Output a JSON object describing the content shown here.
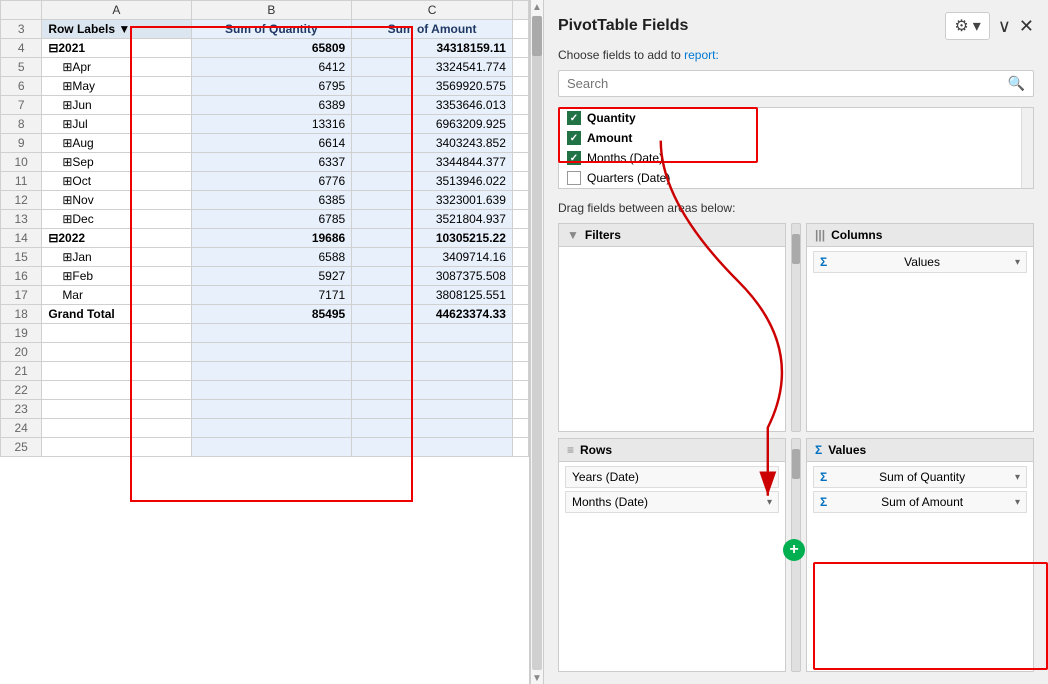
{
  "pivot_panel": {
    "title": "PivotTable Fields",
    "subtitle_text": "Choose fields to add to",
    "subtitle_link": "report:",
    "search_placeholder": "Search",
    "fields": [
      {
        "label": "Quantity",
        "checked": true,
        "bold": true
      },
      {
        "label": "Amount",
        "checked": true,
        "bold": true
      },
      {
        "label": "Months (Date)",
        "checked": true,
        "bold": false
      },
      {
        "label": "Quarters (Date)",
        "checked": false,
        "bold": false
      }
    ],
    "drag_section": "Drag fields between areas below:",
    "areas": {
      "filters": {
        "header": "Filters"
      },
      "columns": {
        "header": "Columns",
        "items": [
          {
            "label": "Values"
          }
        ]
      },
      "rows": {
        "header": "Rows",
        "items": [
          {
            "label": "Years (Date)"
          },
          {
            "label": "Months (Date)"
          }
        ]
      },
      "values": {
        "header": "Values",
        "items": [
          {
            "label": "Sum of Quantity"
          },
          {
            "label": "Sum of Amount"
          }
        ]
      }
    }
  },
  "spreadsheet": {
    "col_headers": [
      "",
      "A",
      "B",
      "C"
    ],
    "header_row": {
      "row_num": "3",
      "col_a": "Row Labels",
      "col_b": "Sum of Quantity",
      "col_c": "Sum of Amount"
    },
    "rows": [
      {
        "row_num": "4",
        "label": "⊟2021",
        "qty": "65809",
        "amt": "34318159.11",
        "type": "year"
      },
      {
        "row_num": "5",
        "label": "⊞Apr",
        "qty": "6412",
        "amt": "3324541.774",
        "type": "sub"
      },
      {
        "row_num": "6",
        "label": "⊞May",
        "qty": "6795",
        "amt": "3569920.575",
        "type": "sub"
      },
      {
        "row_num": "7",
        "label": "⊞Jun",
        "qty": "6389",
        "amt": "3353646.013",
        "type": "sub"
      },
      {
        "row_num": "8",
        "label": "⊞Jul",
        "qty": "13316",
        "amt": "6963209.925",
        "type": "sub"
      },
      {
        "row_num": "9",
        "label": "⊞Aug",
        "qty": "6614",
        "amt": "3403243.852",
        "type": "sub"
      },
      {
        "row_num": "10",
        "label": "⊞Sep",
        "qty": "6337",
        "amt": "3344844.377",
        "type": "sub"
      },
      {
        "row_num": "11",
        "label": "⊞Oct",
        "qty": "6776",
        "amt": "3513946.022",
        "type": "sub"
      },
      {
        "row_num": "12",
        "label": "⊞Nov",
        "qty": "6385",
        "amt": "3323001.639",
        "type": "sub"
      },
      {
        "row_num": "13",
        "label": "⊞Dec",
        "qty": "6785",
        "amt": "3521804.937",
        "type": "sub"
      },
      {
        "row_num": "14",
        "label": "⊟2022",
        "qty": "19686",
        "amt": "10305215.22",
        "type": "year"
      },
      {
        "row_num": "15",
        "label": "⊞Jan",
        "qty": "6588",
        "amt": "3409714.16",
        "type": "sub"
      },
      {
        "row_num": "16",
        "label": "⊞Feb",
        "qty": "5927",
        "amt": "3087375.508",
        "type": "sub"
      },
      {
        "row_num": "17",
        "label": "Mar",
        "qty": "7171",
        "amt": "3808125.551",
        "type": "sub"
      },
      {
        "row_num": "18",
        "label": "Grand Total",
        "qty": "85495",
        "amt": "44623374.33",
        "type": "grand"
      },
      {
        "row_num": "19",
        "label": "",
        "qty": "",
        "amt": "",
        "type": "empty"
      },
      {
        "row_num": "20",
        "label": "",
        "qty": "",
        "amt": "",
        "type": "empty"
      },
      {
        "row_num": "21",
        "label": "",
        "qty": "",
        "amt": "",
        "type": "empty"
      },
      {
        "row_num": "22",
        "label": "",
        "qty": "",
        "amt": "",
        "type": "empty"
      },
      {
        "row_num": "23",
        "label": "",
        "qty": "",
        "amt": "",
        "type": "empty"
      },
      {
        "row_num": "24",
        "label": "",
        "qty": "",
        "amt": "",
        "type": "empty"
      },
      {
        "row_num": "25",
        "label": "",
        "qty": "",
        "amt": "",
        "type": "empty"
      }
    ]
  }
}
